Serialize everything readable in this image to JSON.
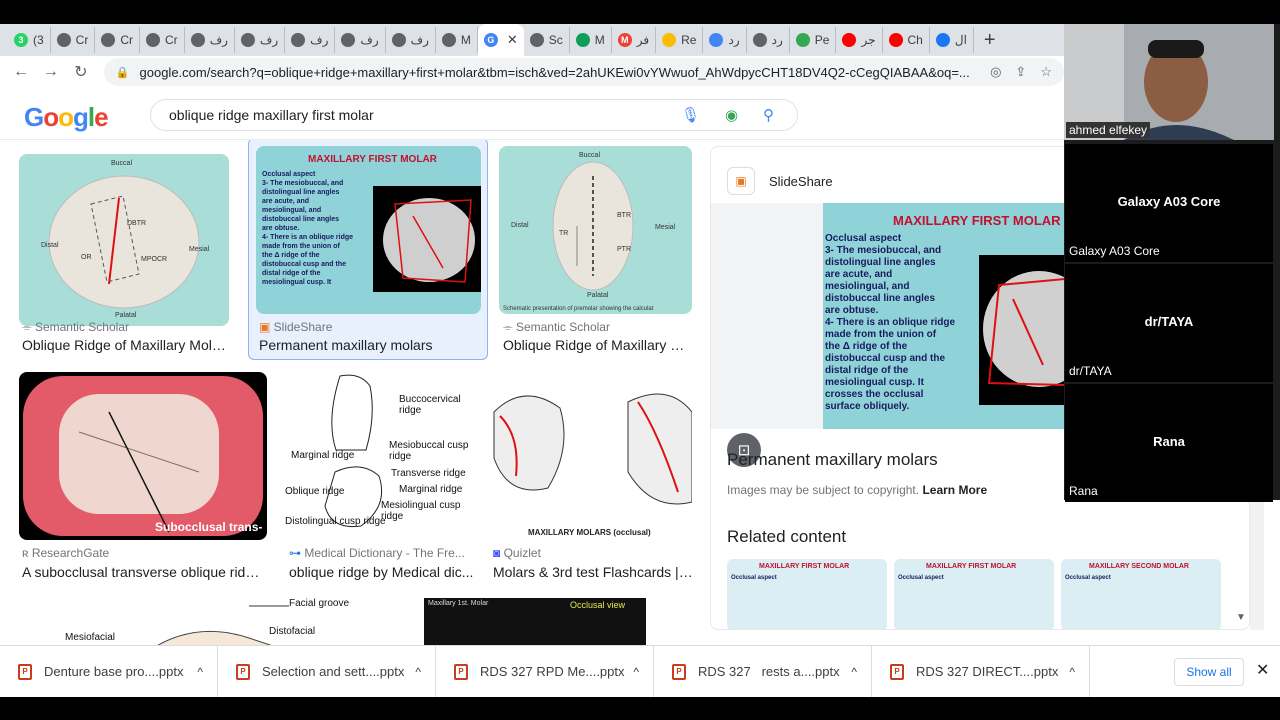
{
  "tabs": [
    {
      "label": "(3",
      "badge": "3",
      "color": "#25d366"
    },
    {
      "label": "Cr",
      "color": "#5f6368"
    },
    {
      "label": "Cr",
      "color": "#5f6368"
    },
    {
      "label": "Cr",
      "color": "#5f6368"
    },
    {
      "label": "رف",
      "color": "#5f6368"
    },
    {
      "label": "رف",
      "color": "#5f6368"
    },
    {
      "label": "رف",
      "color": "#5f6368"
    },
    {
      "label": "رف",
      "color": "#5f6368"
    },
    {
      "label": "رف",
      "color": "#5f6368"
    },
    {
      "label": "M",
      "color": "#5f6368"
    },
    {
      "label": "",
      "badge": "G",
      "color": "#4285f4",
      "active": true
    },
    {
      "label": "Sc",
      "color": "#5f6368"
    },
    {
      "label": "M",
      "color": "#0f9d58"
    },
    {
      "label": "فر",
      "badge": "M",
      "color": "#ea4335"
    },
    {
      "label": "Re",
      "color": "#fbbc05"
    },
    {
      "label": "رد",
      "color": "#4285f4"
    },
    {
      "label": "رد",
      "color": "#5f6368"
    },
    {
      "label": "Pe",
      "color": "#34a853"
    },
    {
      "label": "جر",
      "color": "#ff0000"
    },
    {
      "label": "Ch",
      "color": "#ff0000"
    },
    {
      "label": "ال",
      "color": "#1877f2"
    }
  ],
  "address": {
    "url": "google.com/search?q=oblique+ridge+maxillary+first+molar&tbm=isch&ved=2ahUKEwi0vYWwuof_AhWdpycCHT18DV4Q2-cCegQIABAA&oq=..."
  },
  "search": {
    "logo": "Google",
    "query": "oblique ridge maxillary first molar"
  },
  "results": [
    {
      "source": "Semantic Scholar",
      "title": "Oblique Ridge of Maxillary Molars...",
      "img": {
        "top": "Buccal",
        "left": "Distal",
        "right": "Mesial",
        "bottom": "Palatal",
        "l1": "DBTR",
        "l2": "OR",
        "l3": "MPOCR"
      }
    },
    {
      "source": "SlideShare",
      "title": "Permanent maxillary molars",
      "img": {
        "heading": "MAXILLARY FIRST MOLAR"
      }
    },
    {
      "source": "Semantic Scholar",
      "title": "Oblique Ridge of Maxillary M...",
      "img": {
        "top": "Buccal",
        "left": "Distal",
        "right": "Mesial",
        "bottom": "Palatal",
        "l1": "BTR",
        "l2": "TR",
        "l3": "PTR",
        "caption": "Schematic presentation of premolar showing the calculat"
      }
    },
    {
      "source": "ResearchGate",
      "title": "A subocclusal transverse oblique ridge...",
      "img": {
        "caption": "Subocclusal trans-"
      }
    },
    {
      "source": "Medical Dictionary - The Fre...",
      "title": "oblique ridge by Medical dic...",
      "img": {
        "labels": [
          "Buccocervical ridge",
          "Mesiobuccal cusp ridge",
          "Marginal ridge",
          "Transverse ridge",
          "Marginal ridge",
          "Oblique ridge",
          "Mesiolingual cusp ridge",
          "Distolingual cusp ridge"
        ]
      }
    },
    {
      "source": "Quizlet",
      "title": "Molars & 3rd test Flashcards | ...",
      "img": {
        "caption": "MAXILLARY MOLARS (occlusal)"
      }
    },
    {
      "img": {
        "labels": [
          "Facial groove",
          "Distofacial",
          "Mesiofacial"
        ]
      }
    },
    {
      "img": {
        "heading": "Maxillary 1st. Molar",
        "sub": "Occlusal view"
      }
    }
  ],
  "preview": {
    "site": "SlideShare",
    "slide_heading": "MAXILLARY FIRST MOLAR",
    "slide_text": [
      "Occlusal aspect",
      "3- The mesiobuccal, and",
      "distolingual line angles",
      "are acute, and",
      "mesiolingual, and",
      "distobuccal line angles",
      "are obtuse.",
      "4- There is an oblique ridge",
      "made from the union of",
      "the Δ ridge of the",
      "distobuccal cusp and the",
      "distal ridge of the",
      "mesiolingual cusp. It",
      "crosses the occlusal",
      "surface obliquely."
    ],
    "title": "Permanent maxillary molars",
    "copyright": "Images may be subject to copyright.",
    "learn_more": "Learn More",
    "related": "Related content",
    "related_items": [
      {
        "heading": "MAXILLARY FIRST MOLAR",
        "text": "Occlusal aspect"
      },
      {
        "heading": "MAXILLARY FIRST MOLAR",
        "text": "Occlusal aspect"
      },
      {
        "heading": "MAXILLARY SECOND MOLAR",
        "text": "Occlusal aspect"
      }
    ]
  },
  "participants": [
    {
      "name": "ahmed elfekey"
    },
    {
      "display": "Galaxy A03 Core",
      "name": "Galaxy A03 Core"
    },
    {
      "display": "dr/TAYA",
      "name": "dr/TAYA"
    },
    {
      "display": "Rana",
      "name": "Rana"
    }
  ],
  "downloads": [
    {
      "name": "Denture base pro....pptx"
    },
    {
      "name": "Selection and sett....pptx"
    },
    {
      "name": "RDS 327 RPD Me....pptx"
    },
    {
      "name": "RDS 327   rests a....pptx"
    },
    {
      "name": "RDS 327 DIRECT....pptx"
    }
  ],
  "show_all": "Show all"
}
